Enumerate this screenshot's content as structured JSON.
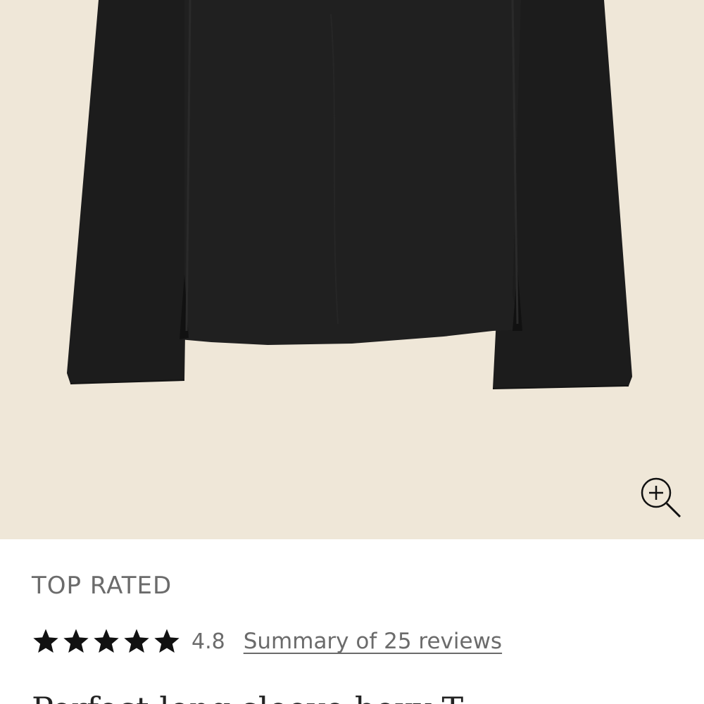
{
  "product_image": {
    "alt": "",
    "background_color": "#efe7d8",
    "garment_color": "#1e1e1e"
  },
  "zoom": {
    "icon": "zoom-in-icon"
  },
  "product": {
    "badge": "TOP RATED",
    "rating": {
      "value": "4.8",
      "stars": 5,
      "icon": "star-icon"
    },
    "reviews_link": "Summary of 25 reviews",
    "title": "Perfect long-sleeve boxy T"
  }
}
